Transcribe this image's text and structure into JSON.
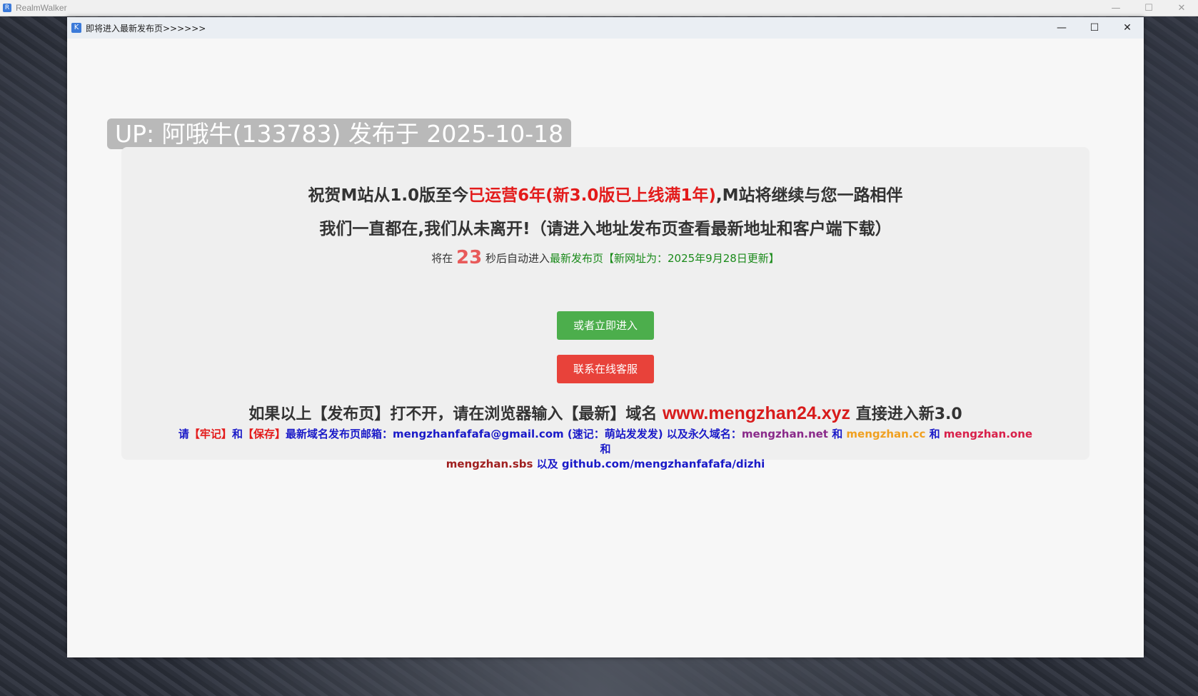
{
  "outer": {
    "app_title": "RealmWalker",
    "controls": [
      "—",
      "☐",
      "✕"
    ]
  },
  "window": {
    "title": "即将进入最新发布页>>>>>>",
    "controls": [
      "—",
      "☐",
      "✕"
    ]
  },
  "badge": "UP: 阿哦牛(133783) 发布于 2025-10-18",
  "message": {
    "line1_a": "祝贺M站从1.0版至今",
    "line1_b": "已运营6年(新3.0版已上线满1年)",
    "line1_c": ",M站将继续与您一路相伴",
    "line2": "我们一直都在,我们从未离开!（请进入地址发布页查看最新地址和客户端下载）",
    "countdown_prefix": "将在",
    "countdown_value": "23",
    "countdown_suffix": "秒后自动进入",
    "countdown_link": "最新发布页【新网址为：2025年9月28日更新】"
  },
  "buttons": {
    "enter_now": "或者立即进入",
    "support": "联系在线客服"
  },
  "fallback": {
    "prefix": "如果以上【发布页】打不开，请在浏览器输入【最新】域名 ",
    "domain": "www.mengzhan24.xyz",
    "suffix": " 直接进入新3.0"
  },
  "remember": {
    "p1": "请",
    "p2": "【牢记】",
    "p3": "和",
    "p4": "【保存】",
    "p5": "最新域名发布页邮箱：mengzhanfafafa@gmail.com (速记：萌站发发发) 以及永久域名：",
    "d1": "mengzhan.net",
    "and1": " 和 ",
    "d2": "mengzhan.cc",
    "and2": " 和 ",
    "d3": "mengzhan.one",
    "and3": " 和",
    "d4": "mengzhan.sbs",
    "p6": " 以及 github.com/mengzhanfafafa/dizhi"
  }
}
